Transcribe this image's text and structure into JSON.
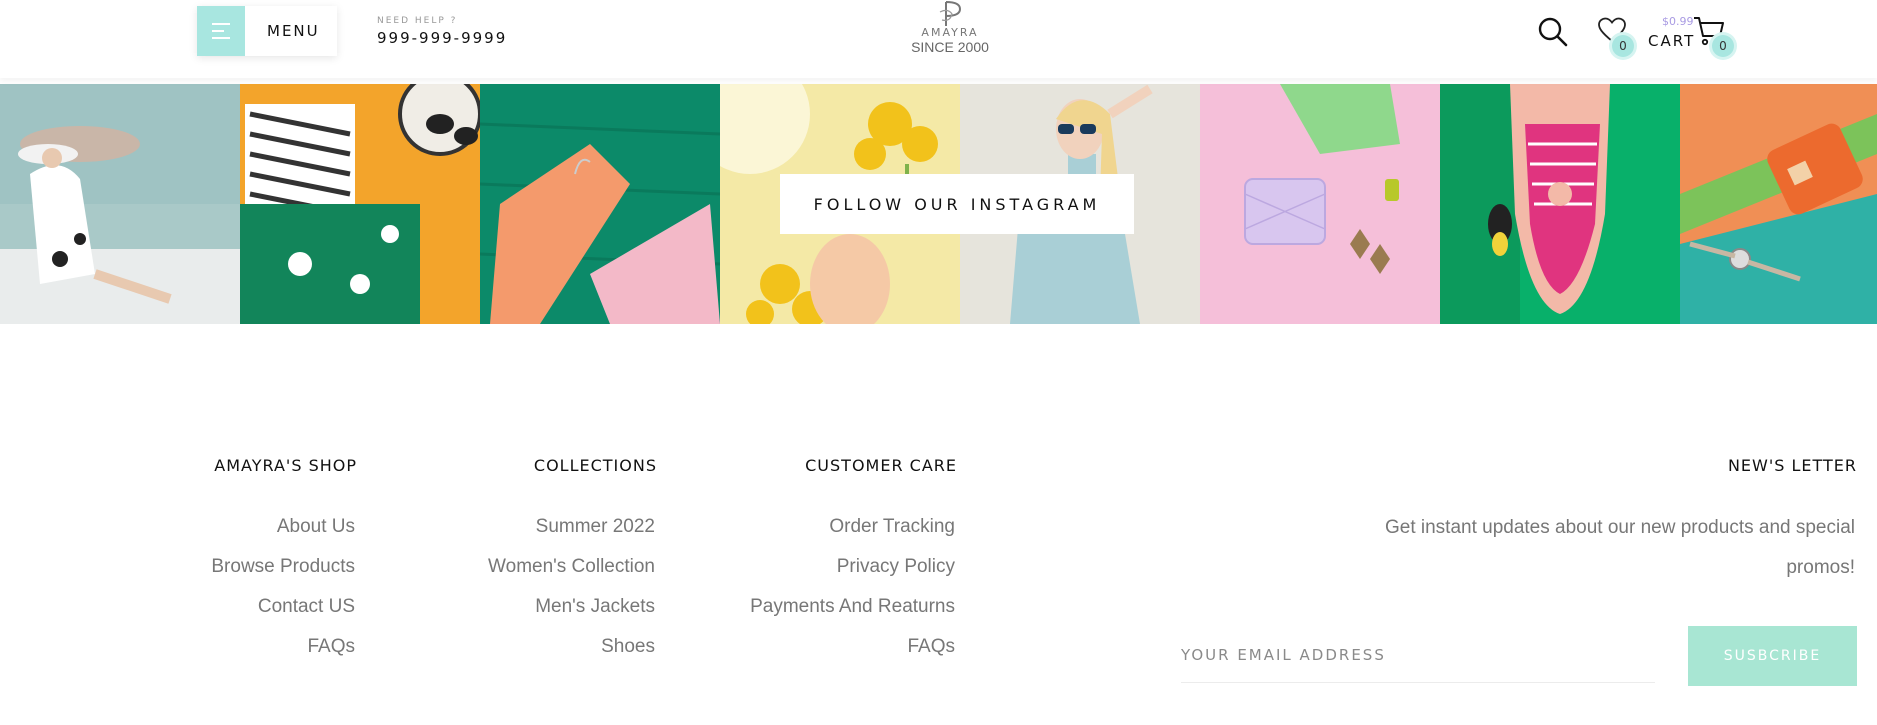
{
  "header": {
    "menu_label": "MENU",
    "help_label": "NEED HELP ?",
    "phone": "999-999-9999",
    "logo_name": "AMAYRA",
    "logo_since": "SINCE 2000",
    "wishlist_count": "0",
    "cart_price": "$0.99",
    "cart_label": "CART",
    "cart_count": "0"
  },
  "instagram": {
    "button_label": "FOLLOW OUR INSTAGRAM"
  },
  "footer": {
    "columns": [
      {
        "heading": "AMAYRA'S SHOP",
        "links": [
          "About Us",
          "Browse Products",
          "Contact US",
          "FAQs"
        ]
      },
      {
        "heading": "COLLECTIONS",
        "links": [
          "Summer 2022",
          "Women's Collection",
          "Men's Jackets",
          "Shoes"
        ]
      },
      {
        "heading": "CUSTOMER CARE",
        "links": [
          "Order Tracking",
          "Privacy Policy",
          "Payments And Reaturns",
          "FAQs"
        ]
      }
    ],
    "newsletter": {
      "heading": "NEW'S LETTER",
      "text": "Get instant updates about our new products and special promos!",
      "email_placeholder": "YOUR EMAIL ADDRESS",
      "subscribe_label": "SUSBCRIBE"
    }
  },
  "colors": {
    "accent": "#a8e6e0",
    "subscribe": "#a8e6d3",
    "price": "#a99be3"
  }
}
